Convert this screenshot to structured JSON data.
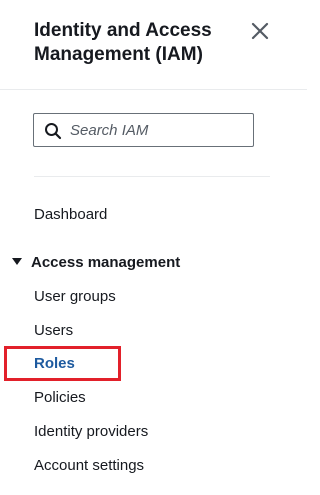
{
  "header": {
    "title": "Identity and Access Management (IAM)"
  },
  "search": {
    "placeholder": "Search IAM",
    "value": ""
  },
  "nav": {
    "dashboard": "Dashboard",
    "section": {
      "label": "Access management",
      "expanded": true,
      "items": [
        {
          "label": "User groups"
        },
        {
          "label": "Users"
        },
        {
          "label": "Roles",
          "active": true
        },
        {
          "label": "Policies"
        },
        {
          "label": "Identity providers"
        },
        {
          "label": "Account settings"
        }
      ]
    }
  },
  "icons": {
    "close": "close-icon",
    "search": "search-icon",
    "caret": "caret-down-icon"
  },
  "colors": {
    "active_link": "#1d5a9f",
    "highlight": "#e2202a",
    "text": "#16191f"
  }
}
